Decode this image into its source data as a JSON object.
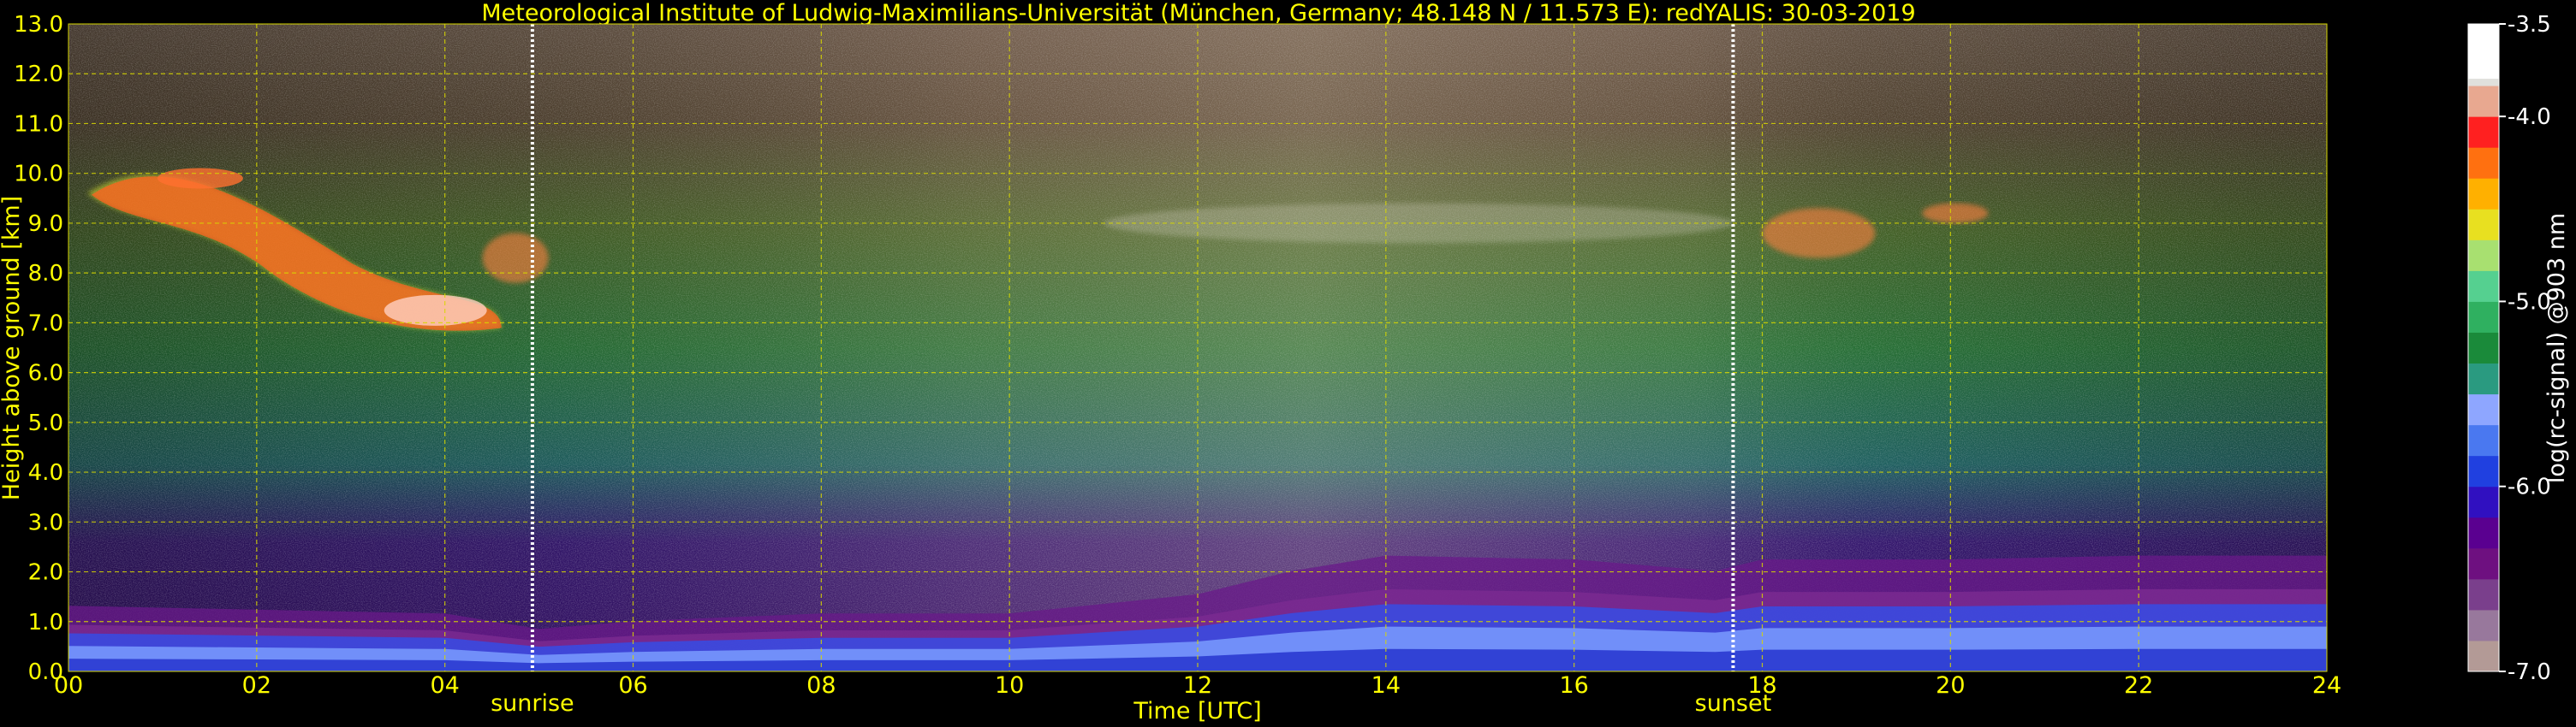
{
  "chart_data": {
    "type": "heatmap",
    "title": "Meteorological Institute of Ludwig-Maximilians-Universität (München, Germany; 48.148 N / 11.573 E):    redYALIS: 30-03-2019",
    "xlabel": "Time [UTC]",
    "ylabel": "Height above ground [km]",
    "colorbar_label": "log(rc-signal) @903 nm",
    "xlim": [
      0,
      24
    ],
    "ylim": [
      0,
      13
    ],
    "clim": [
      -7.0,
      -3.5
    ],
    "x_ticks": [
      "00",
      "02",
      "04",
      "06",
      "08",
      "10",
      "12",
      "14",
      "16",
      "18",
      "20",
      "22",
      "24"
    ],
    "y_ticks": [
      "0.0",
      "1.0",
      "2.0",
      "3.0",
      "4.0",
      "5.0",
      "6.0",
      "7.0",
      "8.0",
      "9.0",
      "10.0",
      "11.0",
      "12.0",
      "13.0"
    ],
    "colorbar_ticks": [
      "-3.5",
      "-4.0",
      "-5.0",
      "-6.0",
      "-7.0"
    ],
    "grid": true,
    "markers": [
      {
        "label": "sunrise",
        "x": 4.93
      },
      {
        "label": "sunset",
        "x": 17.69
      }
    ],
    "boundary_layer_top_km": [
      [
        0,
        0.85
      ],
      [
        2,
        0.8
      ],
      [
        4,
        0.75
      ],
      [
        5,
        0.55
      ],
      [
        6,
        0.65
      ],
      [
        8,
        0.75
      ],
      [
        10,
        0.75
      ],
      [
        12,
        1.0
      ],
      [
        13,
        1.3
      ],
      [
        14,
        1.5
      ],
      [
        16,
        1.45
      ],
      [
        17.5,
        1.3
      ],
      [
        18,
        1.45
      ],
      [
        20,
        1.45
      ],
      [
        22,
        1.5
      ],
      [
        24,
        1.5
      ]
    ],
    "cloud_layers": [
      {
        "x_start": 0.2,
        "x_end": 4.7,
        "base_km": 6.8,
        "top_km": 10.6
      },
      {
        "x_start": 4.4,
        "x_end": 5.1,
        "base_km": 7.8,
        "top_km": 8.8
      },
      {
        "x_start": 11.0,
        "x_end": 17.7,
        "base_km": 8.6,
        "top_km": 9.4
      },
      {
        "x_start": 18.0,
        "x_end": 19.2,
        "base_km": 8.3,
        "top_km": 9.3
      },
      {
        "x_start": 19.7,
        "x_end": 20.4,
        "base_km": 9.0,
        "top_km": 9.4
      }
    ],
    "colorscale": [
      "#b39a96",
      "#98789c",
      "#7a3f8c",
      "#6e1080",
      "#5a0090",
      "#3010c0",
      "#2040e0",
      "#4a78f0",
      "#8ea6ff",
      "#2a9a80",
      "#1a8a3a",
      "#2fb060",
      "#55d090",
      "#a8e070",
      "#e8e020",
      "#ffb000",
      "#ff7010",
      "#ff2020",
      "#e8a890",
      "#e0e0dc",
      "#ffffff"
    ],
    "colors": {
      "annotation": "#ffff00",
      "marker": "#ffffff",
      "grid": "#d8d800",
      "background": "#000000"
    }
  }
}
